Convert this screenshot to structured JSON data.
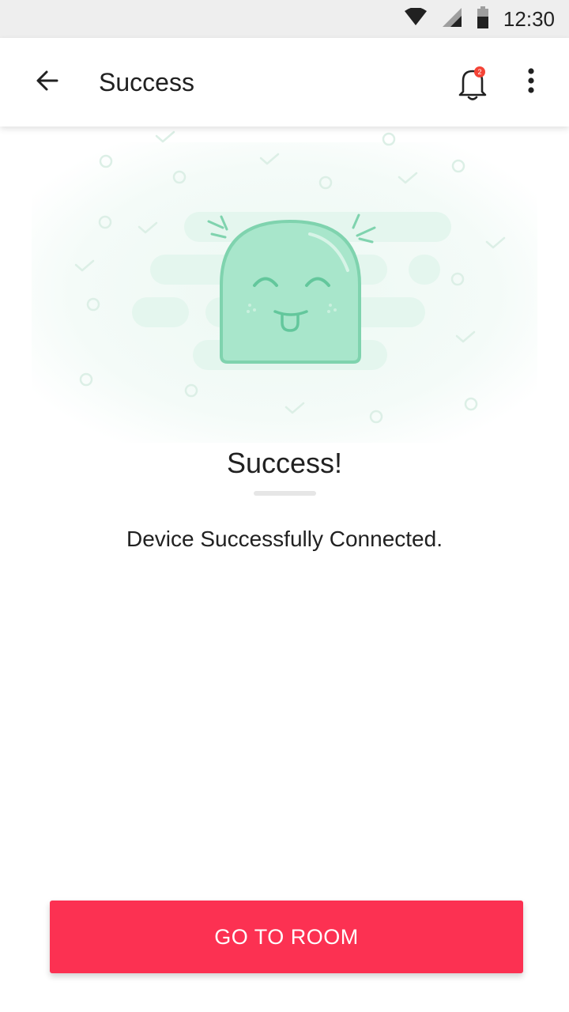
{
  "status_bar": {
    "time": "12:30",
    "icons": [
      "wifi-icon",
      "signal-icon",
      "battery-icon"
    ]
  },
  "app_bar": {
    "title": "Success",
    "back_icon": "arrow-back-icon",
    "notification_icon": "bell-icon",
    "notification_count": "2",
    "menu_icon": "more-vertical-icon"
  },
  "content": {
    "heading": "Success!",
    "message": "Device Successfully Connected."
  },
  "action": {
    "label": "GO TO ROOM"
  },
  "colors": {
    "accent": "#fc3152",
    "mascot": "#a8e6cb",
    "mascot_outline": "#7fd3ae",
    "badge": "#f44336",
    "status_bar": "#eeeeee"
  }
}
